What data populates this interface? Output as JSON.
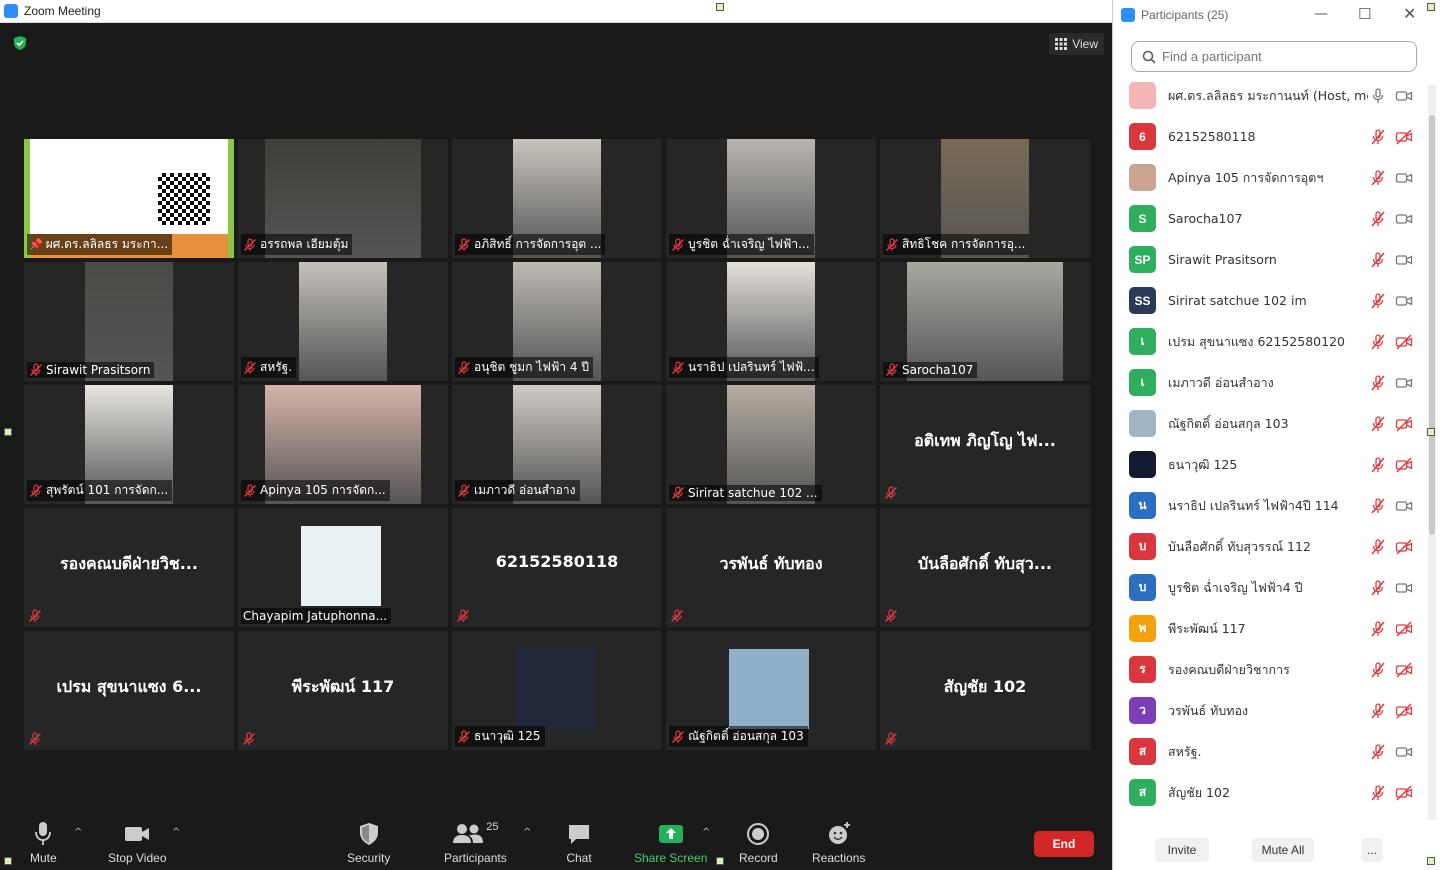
{
  "window": {
    "title": "Zoom Meeting"
  },
  "meeting": {
    "view_label": "View"
  },
  "tiles": [
    {
      "name": "ผศ.ดร.ลลิลธร มระกา...",
      "video": true,
      "active": true,
      "pinned": true
    },
    {
      "name": "อรรถพล เอียมตุ้ม",
      "video": true
    },
    {
      "name": "อภิสิทธิ์ การจัดการอุต ...",
      "video": true
    },
    {
      "name": "บูรชิต ฉ่ำเจริญ ไฟฟ้า...",
      "video": true
    },
    {
      "name": "สิทธิโชค การจัดการอุ...",
      "video": true
    },
    {
      "name": "Sirawit Prasitsorn",
      "video": true
    },
    {
      "name": "สหรัฐ.",
      "video": true
    },
    {
      "name": "อนุชิต ชูมก ไฟฟ้า 4 ปี",
      "video": true
    },
    {
      "name": "นราธิป เปลรินทร์ ไฟฟ้...",
      "video": true
    },
    {
      "name": "Sarocha107",
      "video": true
    },
    {
      "name": "สุพรัตน์ 101 การจัดก...",
      "video": true
    },
    {
      "name": "Apinya 105 การจัดก...",
      "video": true
    },
    {
      "name": "เมภาวดี อ่อนสำอาง",
      "video": true
    },
    {
      "name": "Sirirat satchue 102 ...",
      "video": true
    },
    {
      "name": "อติเทพ ภิญโญ ไฟ...",
      "video": false
    },
    {
      "name": "รองคณบดีฝ่ายวิช...",
      "video": false
    },
    {
      "name": "Chayapim Jatuphonna...",
      "video": true,
      "photo": true
    },
    {
      "name": "62152580118",
      "video": false
    },
    {
      "name": "วรพันธ์ ทับทอง",
      "video": false
    },
    {
      "name": "บันลือศักดิ์ ทับสุว...",
      "video": false
    },
    {
      "name": "เปรม สุขนาแซง 6...",
      "video": false
    },
    {
      "name": "พีระพัฒน์ 117",
      "video": false
    },
    {
      "name": "ธนาวุฒิ 125",
      "video": true,
      "photo": true
    },
    {
      "name": "ณัฐกิตติ์ อ่อนสกุล 103",
      "video": true,
      "photo": true
    },
    {
      "name": "สัญชัย 102",
      "video": false
    }
  ],
  "toolbar": {
    "mute": "Mute",
    "stop_video": "Stop Video",
    "security": "Security",
    "participants_count": "25",
    "participants": "Participants",
    "chat": "Chat",
    "share_screen": "Share Screen",
    "record": "Record",
    "reactions": "Reactions",
    "end": "End"
  },
  "panel": {
    "title": "Participants (25)",
    "search_placeholder": "Find a participant",
    "invite": "Invite",
    "mute_all": "Mute All",
    "more": "...",
    "participants": [
      {
        "name": "ผศ.ดร.ลลิลธร มระกานนท์ (Host, me)",
        "initial": "",
        "color": "#f3b6b6",
        "mic": "on",
        "cam": "on"
      },
      {
        "name": "62152580118",
        "initial": "6",
        "color": "#d9373d",
        "mic": "off",
        "cam": "off"
      },
      {
        "name": "Apinya 105 การจัดการอุตฯ",
        "initial": "",
        "color": "#c9a58f",
        "mic": "off",
        "cam": "on"
      },
      {
        "name": "Sarocha107",
        "initial": "S",
        "color": "#2fae5e",
        "mic": "off",
        "cam": "on"
      },
      {
        "name": "Sirawit Prasitsorn",
        "initial": "SP",
        "color": "#2fae5e",
        "mic": "off",
        "cam": "on"
      },
      {
        "name": "Sirirat satchue 102 im",
        "initial": "SS",
        "color": "#2b3a55",
        "mic": "off",
        "cam": "on"
      },
      {
        "name": "เปรม สุขนาแซง 62152580120",
        "initial": "เ",
        "color": "#2fae5e",
        "mic": "off",
        "cam": "off"
      },
      {
        "name": "เมภาวดี อ่อนสำอาง",
        "initial": "เ",
        "color": "#2fae5e",
        "mic": "off",
        "cam": "on"
      },
      {
        "name": "ณัฐกิตติ์ อ่อนสกุล 103",
        "initial": "",
        "color": "#9fb4c4",
        "mic": "off",
        "cam": "off"
      },
      {
        "name": "ธนาวุฒิ 125",
        "initial": "",
        "color": "#111a2e",
        "mic": "off",
        "cam": "off"
      },
      {
        "name": "นราธิป เปลรินทร์ ไฟฟ้า4ปี 114",
        "initial": "น",
        "color": "#2b6fc2",
        "mic": "off",
        "cam": "on"
      },
      {
        "name": "บันลือศักดิ์ ทับสุวรรณ์ 112",
        "initial": "บ",
        "color": "#d9373d",
        "mic": "off",
        "cam": "off"
      },
      {
        "name": "บูรชิต ฉ่ำเจริญ ไฟฟ้า4 ปี",
        "initial": "บ",
        "color": "#2b6fc2",
        "mic": "off",
        "cam": "on"
      },
      {
        "name": "พีระพัฒน์ 117",
        "initial": "พ",
        "color": "#f2a20c",
        "mic": "off",
        "cam": "off"
      },
      {
        "name": "รองคณบดีฝ่ายวิชาการ",
        "initial": "ร",
        "color": "#d9373d",
        "mic": "off",
        "cam": "off"
      },
      {
        "name": "วรพันธ์ ทับทอง",
        "initial": "ว",
        "color": "#7b3fb8",
        "mic": "off",
        "cam": "off"
      },
      {
        "name": "สหรัฐ.",
        "initial": "ส",
        "color": "#d9373d",
        "mic": "off",
        "cam": "on"
      },
      {
        "name": "สัญชัย 102",
        "initial": "ส",
        "color": "#2fae5e",
        "mic": "off",
        "cam": "off"
      }
    ]
  }
}
